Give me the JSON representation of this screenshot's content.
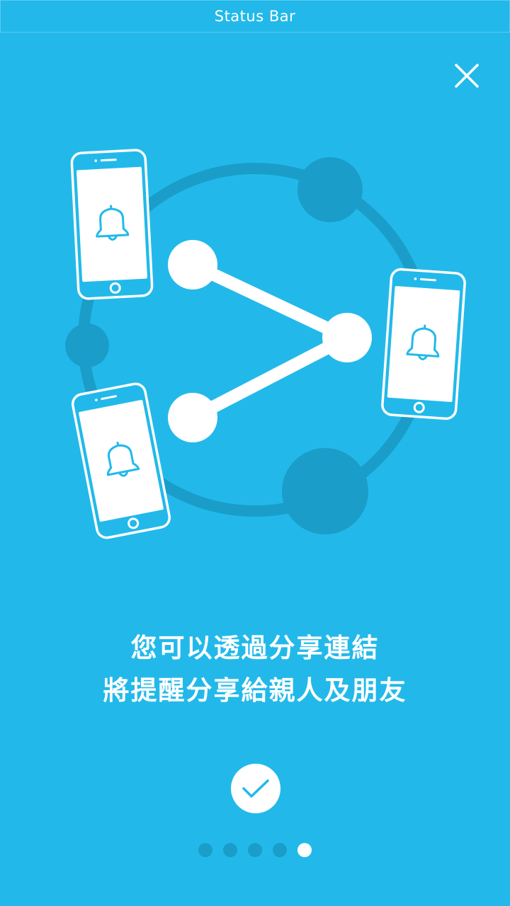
{
  "status_bar": {
    "label": "Status Bar"
  },
  "close_button": {
    "icon": "close-icon"
  },
  "message": {
    "line1": "您可以透過分享連結",
    "line2": "將提醒分享給親人及朋友"
  },
  "confirm_button": {
    "icon": "checkmark-icon"
  },
  "pagination": {
    "total": 5,
    "current": 5
  },
  "colors": {
    "background": "#22b9ea",
    "ring": "#1a9dc9",
    "foreground": "#ffffff"
  }
}
